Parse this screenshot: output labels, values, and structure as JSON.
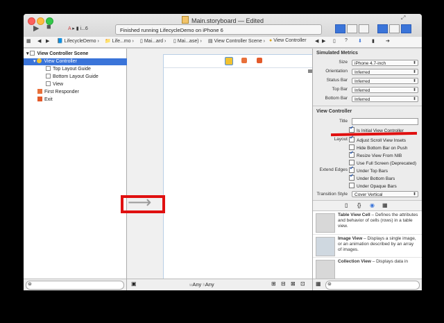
{
  "window": {
    "title": "Main.storyboard — Edited"
  },
  "toolbar": {
    "scheme_device": "i...6",
    "activity_text": "Finished running LifecycleDemo on iPhone 6"
  },
  "jumpbar": [
    "LifecycleDemo",
    "Life...mo",
    "Mai...ard",
    "Mai...ase)",
    "View Controller Scene",
    "View Controller"
  ],
  "outline": {
    "scene": "View Controller Scene",
    "items": [
      "View Controller",
      "Top Layout Guide",
      "Bottom Layout Guide",
      "View",
      "First Responder",
      "Exit"
    ]
  },
  "canvas": {
    "size_class_w": "w",
    "size_class_any1": "Any",
    "size_class_h": "h",
    "size_class_any2": "Any"
  },
  "inspector": {
    "simulated_metrics": {
      "heading": "Simulated Metrics",
      "size_label": "Size",
      "size_value": "iPhone 4.7-inch",
      "orientation_label": "Orientation",
      "orientation_value": "Inferred",
      "status_bar_label": "Status Bar",
      "status_bar_value": "Inferred",
      "top_bar_label": "Top Bar",
      "top_bar_value": "Inferred",
      "bottom_bar_label": "Bottom Bar",
      "bottom_bar_value": "Inferred"
    },
    "view_controller": {
      "heading": "View Controller",
      "title_label": "Title",
      "title_value": "",
      "is_initial": "Is Initial View Controller",
      "layout_label": "Layout",
      "adjust_scroll": "Adjust Scroll View Insets",
      "hide_bottom": "Hide Bottom Bar on Push",
      "resize_nib": "Resize View From NIB",
      "full_screen": "Use Full Screen (Deprecated)",
      "extend_label": "Extend Edges",
      "under_top": "Under Top Bars",
      "under_bottom": "Under Bottom Bars",
      "under_opaque": "Under Opaque Bars",
      "transition_label": "Transition Style",
      "transition_value": "Cover Vertical"
    },
    "library": [
      {
        "name": "Table View Cell",
        "desc": " – Defines the attributes and behavior of cells (rows) in a table view."
      },
      {
        "name": "Image View",
        "desc": " – Displays a single image, or an animation described by an array of images."
      },
      {
        "name": "Collection View",
        "desc": " – Displays data in"
      }
    ]
  },
  "colors": {
    "accent": "#3a74d9",
    "highlight": "#e01010"
  }
}
